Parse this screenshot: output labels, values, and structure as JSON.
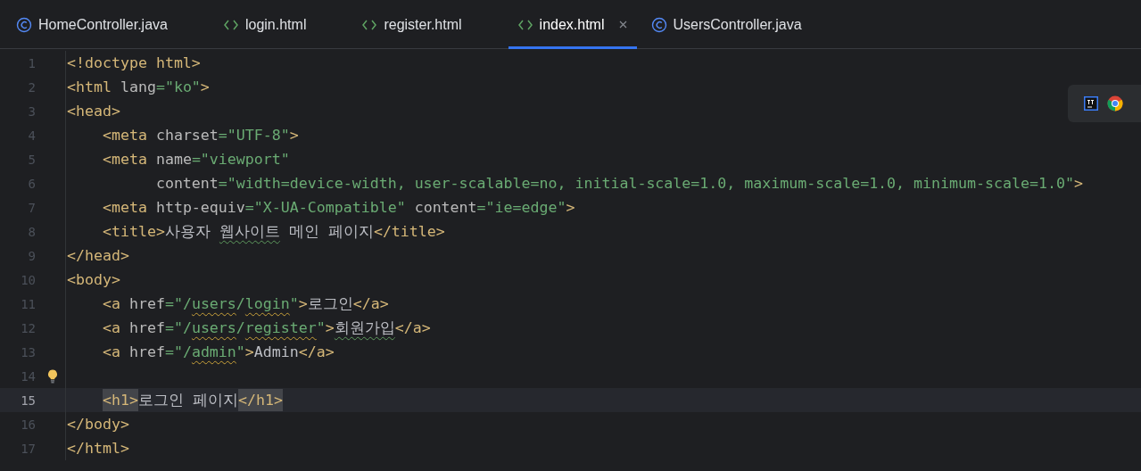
{
  "tabs": [
    {
      "label": "HomeController.java",
      "kind": "java",
      "selected": false
    },
    {
      "label": "login.html",
      "kind": "html",
      "selected": false
    },
    {
      "label": "register.html",
      "kind": "html",
      "selected": false
    },
    {
      "label": "index.html",
      "kind": "html",
      "selected": true
    },
    {
      "label": "UsersController.java",
      "kind": "java",
      "selected": false
    }
  ],
  "editor": {
    "lines": [
      {
        "number": "1",
        "current": false,
        "tokens": [
          {
            "text": "<!doctype html>",
            "kind": "tag"
          }
        ]
      },
      {
        "number": "2",
        "current": false,
        "tokens": [
          {
            "text": "<html",
            "kind": "tag"
          },
          {
            "text": " lang",
            "kind": "attr"
          },
          {
            "text": "=\"ko\"",
            "kind": "str"
          },
          {
            "text": ">",
            "kind": "tag"
          }
        ]
      },
      {
        "number": "3",
        "current": false,
        "tokens": [
          {
            "text": "<head>",
            "kind": "tag"
          }
        ]
      },
      {
        "number": "4",
        "current": false,
        "tokens": [
          {
            "text": "    <meta",
            "kind": "tag"
          },
          {
            "text": " charset",
            "kind": "attr"
          },
          {
            "text": "=\"UTF-8\"",
            "kind": "str"
          },
          {
            "text": ">",
            "kind": "tag"
          }
        ]
      },
      {
        "number": "5",
        "current": false,
        "tokens": [
          {
            "text": "    <meta",
            "kind": "tag"
          },
          {
            "text": " name",
            "kind": "attr"
          },
          {
            "text": "=\"viewport\"",
            "kind": "str"
          }
        ]
      },
      {
        "number": "6",
        "current": false,
        "tokens": [
          {
            "text": "          content",
            "kind": "attr"
          },
          {
            "text": "=\"width=device-width, user-scalable=no, initial-scale=1.0, maximum-scale=1.0, minimum-scale=1.0\"",
            "kind": "str"
          },
          {
            "text": ">",
            "kind": "tag"
          }
        ]
      },
      {
        "number": "7",
        "current": false,
        "tokens": [
          {
            "text": "    <meta",
            "kind": "tag"
          },
          {
            "text": " http-equiv",
            "kind": "attr"
          },
          {
            "text": "=\"X-UA-Compatible\"",
            "kind": "str"
          },
          {
            "text": " content",
            "kind": "attr"
          },
          {
            "text": "=\"ie=edge\"",
            "kind": "str"
          },
          {
            "text": ">",
            "kind": "tag"
          }
        ]
      },
      {
        "number": "8",
        "current": false,
        "tokens": [
          {
            "text": "    <title>",
            "kind": "tag"
          },
          {
            "text": "사용자 ",
            "kind": "text"
          },
          {
            "text": "웹사이트",
            "kind": "text",
            "typo": true
          },
          {
            "text": " 메인 페이지",
            "kind": "text"
          },
          {
            "text": "</title>",
            "kind": "tag"
          }
        ]
      },
      {
        "number": "9",
        "current": false,
        "tokens": [
          {
            "text": "</head>",
            "kind": "tag"
          }
        ]
      },
      {
        "number": "10",
        "current": false,
        "tokens": [
          {
            "text": "<body>",
            "kind": "tag"
          }
        ]
      },
      {
        "number": "11",
        "current": false,
        "tokens": [
          {
            "text": "    <a",
            "kind": "tag"
          },
          {
            "text": " href",
            "kind": "attr"
          },
          {
            "text": "=\"/",
            "kind": "str"
          },
          {
            "text": "users",
            "kind": "str",
            "warning": true
          },
          {
            "text": "/",
            "kind": "str"
          },
          {
            "text": "login",
            "kind": "str",
            "warning": true
          },
          {
            "text": "\"",
            "kind": "str"
          },
          {
            "text": ">",
            "kind": "tag"
          },
          {
            "text": "로그인",
            "kind": "text"
          },
          {
            "text": "</a>",
            "kind": "tag"
          }
        ]
      },
      {
        "number": "12",
        "current": false,
        "tokens": [
          {
            "text": "    <a",
            "kind": "tag"
          },
          {
            "text": " href",
            "kind": "attr"
          },
          {
            "text": "=\"/",
            "kind": "str"
          },
          {
            "text": "users",
            "kind": "str",
            "warning": true
          },
          {
            "text": "/",
            "kind": "str"
          },
          {
            "text": "register",
            "kind": "str",
            "warning": true
          },
          {
            "text": "\"",
            "kind": "str"
          },
          {
            "text": ">",
            "kind": "tag"
          },
          {
            "text": "회원가입",
            "kind": "text",
            "typo": true
          },
          {
            "text": "</a>",
            "kind": "tag"
          }
        ]
      },
      {
        "number": "13",
        "current": false,
        "tokens": [
          {
            "text": "    <a",
            "kind": "tag"
          },
          {
            "text": " href",
            "kind": "attr"
          },
          {
            "text": "=\"/",
            "kind": "str"
          },
          {
            "text": "admin",
            "kind": "str",
            "warning": true
          },
          {
            "text": "\"",
            "kind": "str"
          },
          {
            "text": ">",
            "kind": "tag"
          },
          {
            "text": "Admin",
            "kind": "text"
          },
          {
            "text": "</a>",
            "kind": "tag"
          }
        ]
      },
      {
        "number": "14",
        "current": false,
        "hint": true
      },
      {
        "number": "15",
        "current": true,
        "indented": true,
        "tokens": [
          {
            "text": "<h1>",
            "kind": "tag",
            "matched": true
          },
          {
            "text": "로그인 페이지",
            "kind": "text"
          },
          {
            "text": "</h1>",
            "kind": "tag",
            "matched": true
          }
        ]
      },
      {
        "number": "16",
        "current": false,
        "tokens": [
          {
            "text": "</body>",
            "kind": "tag"
          }
        ]
      },
      {
        "number": "17",
        "current": false,
        "tokens": [
          {
            "text": "</html>",
            "kind": "tag"
          }
        ]
      }
    ]
  },
  "floating_toolbar": {
    "browsers": [
      {
        "kind": "intellij"
      },
      {
        "kind": "chrome"
      }
    ]
  }
}
